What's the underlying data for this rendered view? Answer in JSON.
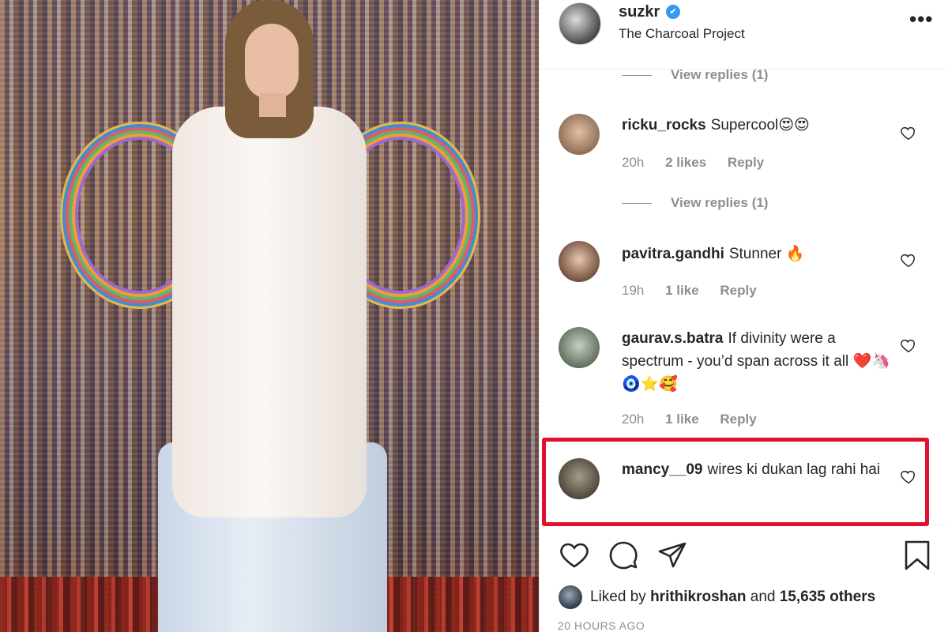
{
  "post": {
    "username": "suzkr",
    "verified_mark": "✔",
    "location": "The Charcoal Project",
    "more_icon": "more-horizontal-icon"
  },
  "comments": [
    {
      "view_replies": "View replies (1)"
    },
    {
      "username": "ricku_rocks",
      "text": "Supercool😍😍",
      "time": "20h",
      "likes": "2 likes",
      "reply": "Reply",
      "view_replies": "View replies (1)"
    },
    {
      "username": "pavitra.gandhi",
      "text": "Stunner 🔥",
      "time": "19h",
      "likes": "1 like",
      "reply": "Reply"
    },
    {
      "username": "gaurav.s.batra",
      "text": "If divinity were a spectrum - you’d span across it all ❤️🦄🧿⭐🥰",
      "time": "20h",
      "likes": "1 like",
      "reply": "Reply"
    },
    {
      "username": "mancy__09",
      "text": "wires ki dukan lag rahi hai"
    }
  ],
  "liked_by": {
    "prefix": "Liked by",
    "user": "hrithikroshan",
    "and": "and",
    "others": "15,635 others"
  },
  "timestamp": "20 HOURS AGO",
  "colors": {
    "highlight": "#e0102f",
    "muted": "#8e8e8e",
    "verified": "#3897f0"
  }
}
